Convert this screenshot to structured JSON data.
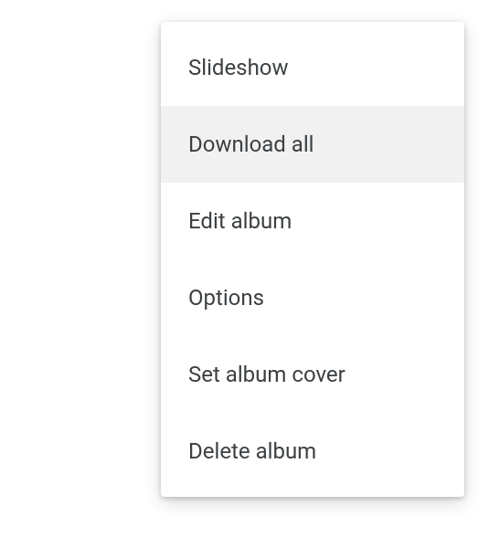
{
  "menu": {
    "items": [
      {
        "label": "Slideshow",
        "hovered": false
      },
      {
        "label": "Download all",
        "hovered": true
      },
      {
        "label": "Edit album",
        "hovered": false
      },
      {
        "label": "Options",
        "hovered": false
      },
      {
        "label": "Set album cover",
        "hovered": false
      },
      {
        "label": "Delete album",
        "hovered": false
      }
    ]
  }
}
